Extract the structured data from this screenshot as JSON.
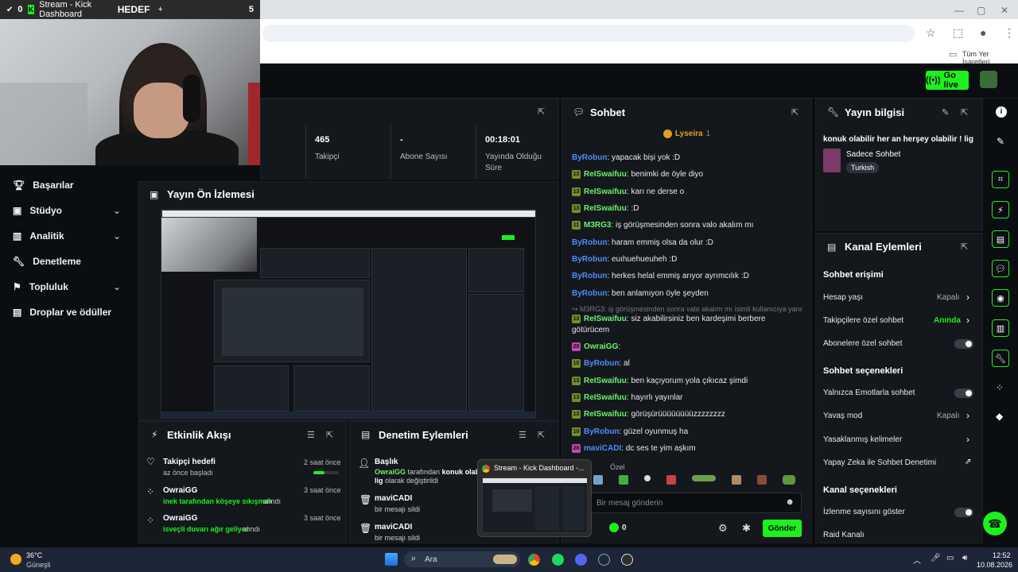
{
  "browser": {
    "tab_counter": "0",
    "tab_title": "Stream - Kick Dashboard",
    "tab_group": "HEDEF",
    "new_tab": "+",
    "tab_count": "5",
    "bookmarks_label": "Tüm Yer İşaretleri"
  },
  "header": {
    "go_live": "Go live"
  },
  "sidebar": {
    "items": [
      {
        "label": "Başarılar"
      },
      {
        "label": "Stüdyo"
      },
      {
        "label": "Analitik"
      },
      {
        "label": "Denetleme"
      },
      {
        "label": "Topluluk"
      },
      {
        "label": "Droplar ve ödüller"
      }
    ]
  },
  "stats": {
    "followers_value": "465",
    "followers_label": "Takipçi",
    "subs_value": "-",
    "subs_label": "Abone Sayısı",
    "uptime_value": "00:18:01",
    "uptime_label_1": "Yayında Olduğu",
    "uptime_label_2": "Süre"
  },
  "preview": {
    "title": "Yayın Ön İzlemesi"
  },
  "activity": {
    "title": "Etkinlik Akışı",
    "items": [
      {
        "name": "Takipçi hedefi",
        "sub": "az önce başladı",
        "time": "2 saat önce"
      },
      {
        "name": "OwraiGG",
        "sub": "inek tarafından köşeye sıkışmak",
        "suffix": "alındı",
        "time": "3 saat önce"
      },
      {
        "name": "OwraiGG",
        "sub": "isveçli duvarı ağır geliyor",
        "suffix": "alındı",
        "time": "3 saat önce"
      }
    ]
  },
  "moderation": {
    "title": "Denetim Eylemleri",
    "items": [
      {
        "name": "Başlık",
        "line1_user": "OwraiGG",
        "line1_text": "tarafından",
        "line1_bold": "konuk olabili",
        "line2_bold": "lig",
        "line2_text": "olarak değiştirildi"
      },
      {
        "name": "maviCADI",
        "sub": "bir mesajı sildi"
      },
      {
        "name": "maviCADI",
        "sub": "bir mesajı sildi"
      }
    ]
  },
  "chat": {
    "title": "Sohbet",
    "pinned_user": "Lyseira",
    "pinned_count": "1",
    "messages": [
      {
        "badge": "",
        "user": "ByRobun",
        "color": "b",
        "text": ": yapacak bişi yok :D"
      },
      {
        "badge": "13",
        "user": "ReISwaifuu",
        "color": "g",
        "text": ": benimki de öyle diyo"
      },
      {
        "badge": "13",
        "user": "ReISwaifuu",
        "color": "g",
        "text": ": karı ne derse o"
      },
      {
        "badge": "13",
        "user": "ReISwaifuu",
        "color": "g",
        "text": ": :D"
      },
      {
        "badge": "11",
        "user": "M3RG3",
        "color": "g",
        "text": ": iş görüşmesinden sonra valo akalım mı"
      },
      {
        "badge": "",
        "user": "ByRobun",
        "color": "b",
        "text": ": haram emmiş olsa da olur :D"
      },
      {
        "badge": "",
        "user": "ByRobun",
        "color": "b",
        "text": ": euıhuehueuheh :D"
      },
      {
        "badge": "",
        "user": "ByRobun",
        "color": "b",
        "text": ": herkes helal emmiş arıyor ayrımcılık :D"
      },
      {
        "badge": "",
        "user": "ByRobun",
        "color": "b",
        "text": ": ben anlamıyon öyle şeyden"
      }
    ],
    "reply_ref": "↪ M3RG3: iş görüşmesinden sonra valo akalım mı isimli kullanıcıya yanıt ...",
    "messages2": [
      {
        "badge": "13",
        "user": "ReISwaifuu",
        "color": "g",
        "text": ": siz akabilirsiniz ben kardeşimi berbere"
      },
      {
        "badge": "",
        "user": "",
        "color": "g",
        "text": "götürücem"
      },
      {
        "badge": "28",
        "user": "OwraiGG",
        "color": "g",
        "text": ":"
      },
      {
        "badge": "10",
        "user": "ByRobun",
        "color": "b",
        "text": ": al"
      },
      {
        "badge": "13",
        "user": "ReISwaifuu",
        "color": "g",
        "text": ": ben kaçıyorum yola çıkıcaz şimdi"
      },
      {
        "badge": "13",
        "user": "ReISwaifuu",
        "color": "g",
        "text": ": hayırlı yayınlar"
      },
      {
        "badge": "13",
        "user": "ReISwaifuu",
        "color": "g",
        "text": ": görüşürüüüüüüüüzzzzzzzz"
      },
      {
        "badge": "10",
        "user": "ByRobun",
        "color": "b",
        "text": ": güzel oyunmuş ha"
      },
      {
        "badge": "28",
        "user": "maviCADI",
        "color": "b",
        "text": ": dc ses te yim aşkım"
      }
    ],
    "emote_label": "Özel",
    "input_placeholder": "Bir mesaj gönderin",
    "points": "0",
    "send": "Gönder"
  },
  "tooltip": {
    "title": "Stream - Kick Dashboard -..."
  },
  "stream_info": {
    "title": "Yayın bilgisi",
    "stream_title": "konuk olabilir her an herşey olabilir ! lig",
    "category": "Sadece Sohbet",
    "tag": "Turkish"
  },
  "channel_actions": {
    "title": "Kanal Eylemleri",
    "chat_access": "Sohbet erişimi",
    "account_age": "Hesap yaşı",
    "account_age_val": "Kapalı",
    "followers_only": "Takipçilere özel sohbet",
    "followers_only_val": "Anında",
    "subs_only": "Abonelere özel sohbet",
    "chat_options": "Sohbet seçenekleri",
    "emotes_only": "Yalnızca Emotlarla sohbet",
    "slow_mode": "Yavaş mod",
    "slow_mode_val": "Kapalı",
    "banned_words": "Yasaklanmış kelimeler",
    "ai_mod": "Yapay Zeka ile Sohbet Denetimi",
    "channel_options": "Kanal seçenekleri",
    "viewer_count": "İzlenme sayısını göster",
    "raid": "Raid Kanalı"
  },
  "taskbar": {
    "temp": "36°C",
    "weather": "Güneşli",
    "search": "Ara",
    "time": "12:52",
    "date": "10.08.2026"
  },
  "colors": {
    "accent": "#1df01d",
    "panel": "#14181d",
    "background": "#0b0e11"
  }
}
